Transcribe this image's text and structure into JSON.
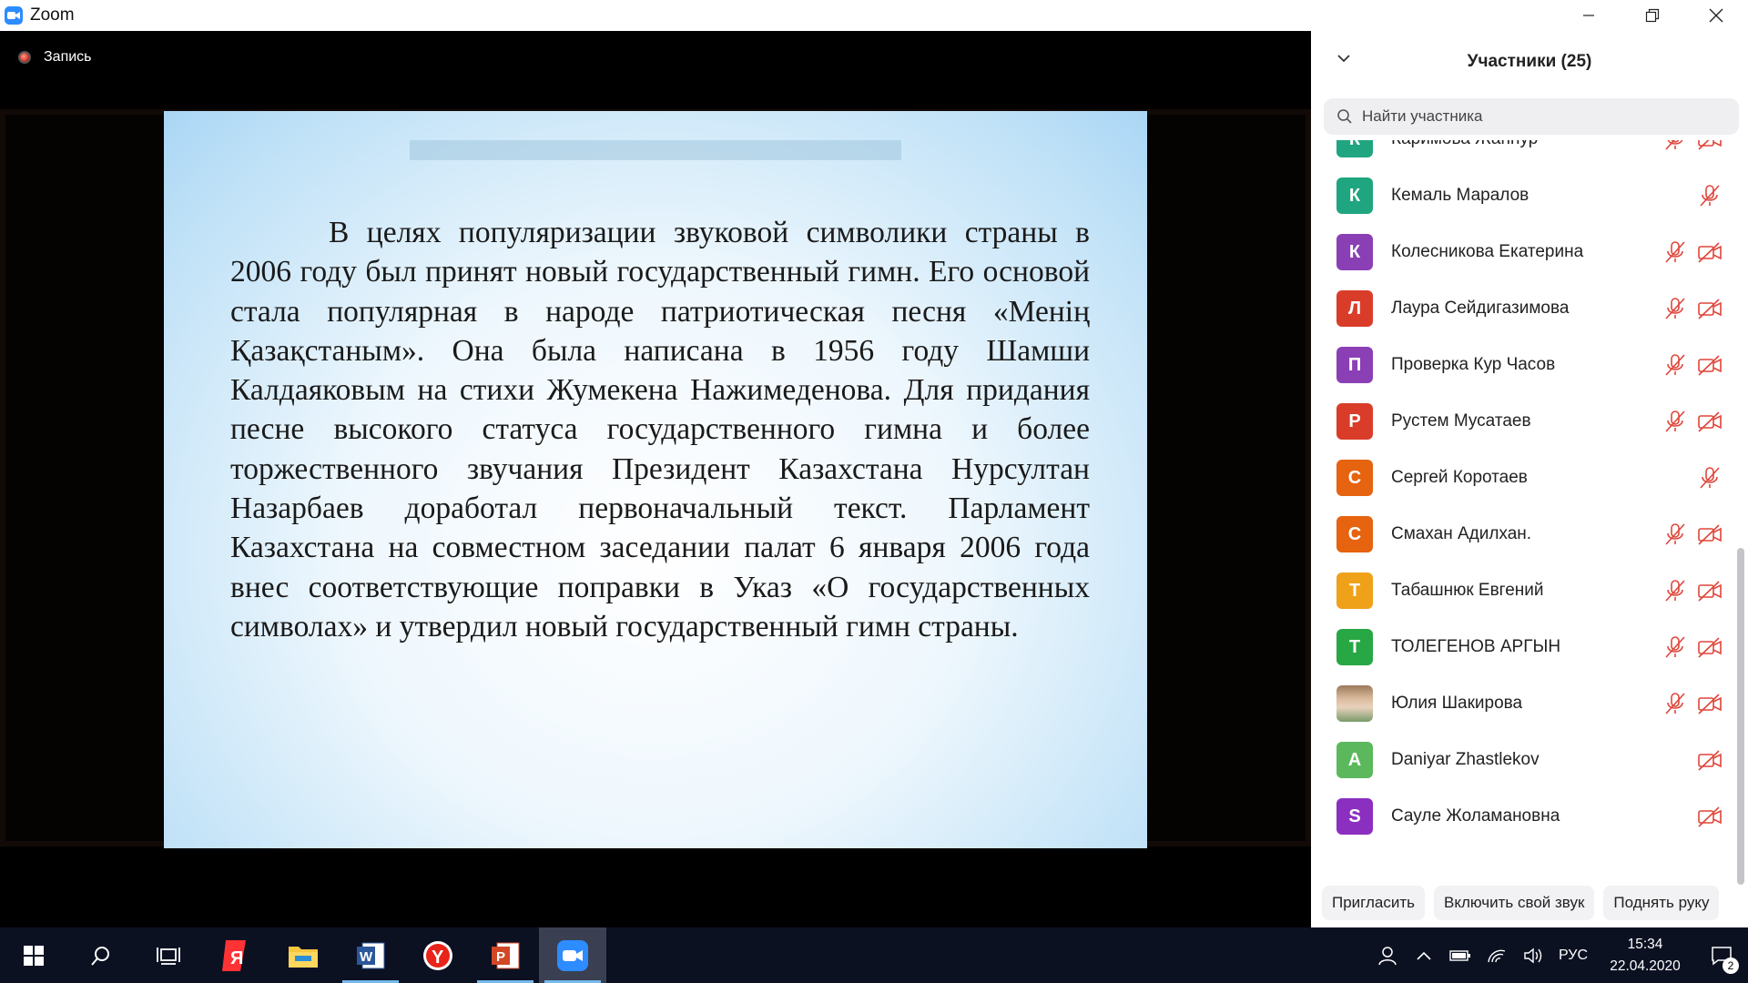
{
  "window": {
    "title": "Zoom"
  },
  "recording": {
    "label": "Запись"
  },
  "slide": {
    "text": "В целях популяризации звуковой символики страны в 2006 году был принят новый государственный гимн. Его основой стала популярная в народе патриотическая песня «Менің Қазақстаным». Она была написана в 1956 году Шамши Калдаяковым на стихи Жумекена Нажимеденова. Для придания песне высокого статуса государственного гимна и более торжественного звучания Президент Казахстана Нурсултан Назарбаев доработал первоначальный текст. Парламент Казахстана на совместном заседании палат 6 января 2006 года внес соответствующие поправки в Указ «О государственных символах» и утвердил новый государственный гимн страны."
  },
  "participants": {
    "title": "Участники (25)",
    "search_placeholder": "Найти участника",
    "items": [
      {
        "initial": "К",
        "name": "Каримова Жаннур",
        "color": "#1fa57f",
        "mic_muted": true,
        "video_off": true
      },
      {
        "initial": "К",
        "name": "Кемаль Маралов",
        "color": "#1fa57f",
        "mic_muted": true,
        "video_off": false
      },
      {
        "initial": "К",
        "name": "Колесникова Екатерина",
        "color": "#8b3fb5",
        "mic_muted": true,
        "video_off": true
      },
      {
        "initial": "Л",
        "name": "Лаура Сейдигазимова",
        "color": "#d93d2a",
        "mic_muted": true,
        "video_off": true
      },
      {
        "initial": "П",
        "name": "Проверка Кур Часов",
        "color": "#8b3fb5",
        "mic_muted": true,
        "video_off": true
      },
      {
        "initial": "Р",
        "name": "Рустем Мусатаев",
        "color": "#d93d2a",
        "mic_muted": true,
        "video_off": true
      },
      {
        "initial": "С",
        "name": "Сергей Коротаев",
        "color": "#e6630f",
        "mic_muted": true,
        "video_off": false
      },
      {
        "initial": "С",
        "name": "Смахан Адилхан.",
        "color": "#e6630f",
        "mic_muted": true,
        "video_off": true
      },
      {
        "initial": "Т",
        "name": "Табашнюк Евгений",
        "color": "#f0a11a",
        "mic_muted": true,
        "video_off": true
      },
      {
        "initial": "Т",
        "name": "ТОЛЕГЕНОВ АРГЫН",
        "color": "#28a745",
        "mic_muted": true,
        "video_off": true
      },
      {
        "initial": "",
        "name": "Юлия Шакирова",
        "color": "photo",
        "mic_muted": true,
        "video_off": true
      },
      {
        "initial": "A",
        "name": "Daniyar Zhastlekov",
        "color": "#5cb85c",
        "mic_muted": false,
        "video_off": true
      },
      {
        "initial": "S",
        "name": "Сауле Жоламановна",
        "color": "#8b2fc0",
        "mic_muted": false,
        "video_off": true
      }
    ],
    "buttons": {
      "invite": "Пригласить",
      "unmute": "Включить свой звук",
      "raise_hand": "Поднять руку"
    }
  },
  "taskbar": {
    "lang": "РУС",
    "time": "15:34",
    "date": "22.04.2020",
    "notifications": "2",
    "apps": [
      {
        "name": "start-button",
        "icon": "windows-icon"
      },
      {
        "name": "search-button",
        "icon": "search-icon"
      },
      {
        "name": "task-view-button",
        "icon": "task-view-icon"
      },
      {
        "name": "yandex-app",
        "icon": "yandex-icon"
      },
      {
        "name": "explorer-app",
        "icon": "folder-icon"
      },
      {
        "name": "word-app",
        "icon": "word-icon"
      },
      {
        "name": "yandex-browser-app",
        "icon": "yandex-browser-icon"
      },
      {
        "name": "powerpoint-app",
        "icon": "powerpoint-icon"
      },
      {
        "name": "zoom-app",
        "icon": "zoom-icon"
      }
    ]
  }
}
